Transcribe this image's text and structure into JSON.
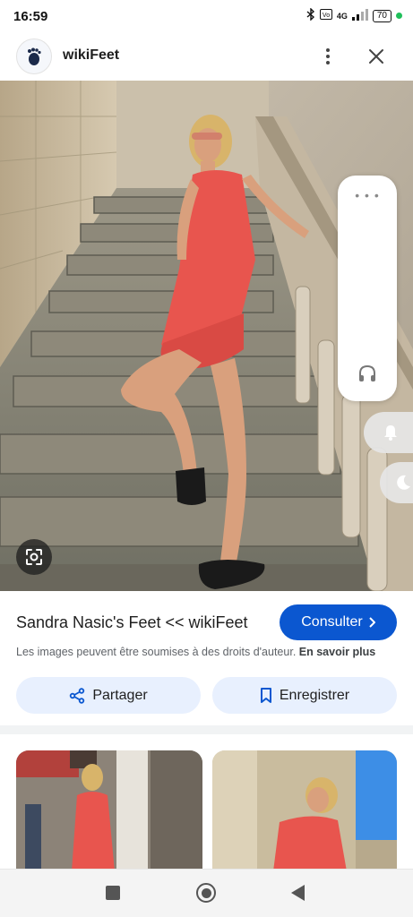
{
  "status_bar": {
    "time": "16:59",
    "network_label": "4G",
    "battery": "70",
    "icons": [
      "bluetooth-icon",
      "volte-icon",
      "signal-icon",
      "battery-icon"
    ]
  },
  "header": {
    "site_name": "wikiFeet",
    "logo_icon": "wikifeet-logo",
    "more_icon": "more-vert-icon",
    "close_icon": "close-icon"
  },
  "hero": {
    "lens_icon": "google-lens-icon"
  },
  "side_panel": {
    "icons": [
      "more-horiz-icon",
      "headphones-icon",
      "bell-icon",
      "moon-icon"
    ]
  },
  "info": {
    "title": "Sandra Nasic's Feet << wikiFeet",
    "visit_label": "Consulter",
    "copyright_text": "Les images peuvent être soumises à des droits d'auteur.",
    "learn_more": "En savoir plus",
    "share_label": "Partager",
    "save_label": "Enregistrer"
  },
  "colors": {
    "accent": "#0b57d0",
    "button_tint": "#e8f0fe",
    "dress": "#e8554e"
  }
}
